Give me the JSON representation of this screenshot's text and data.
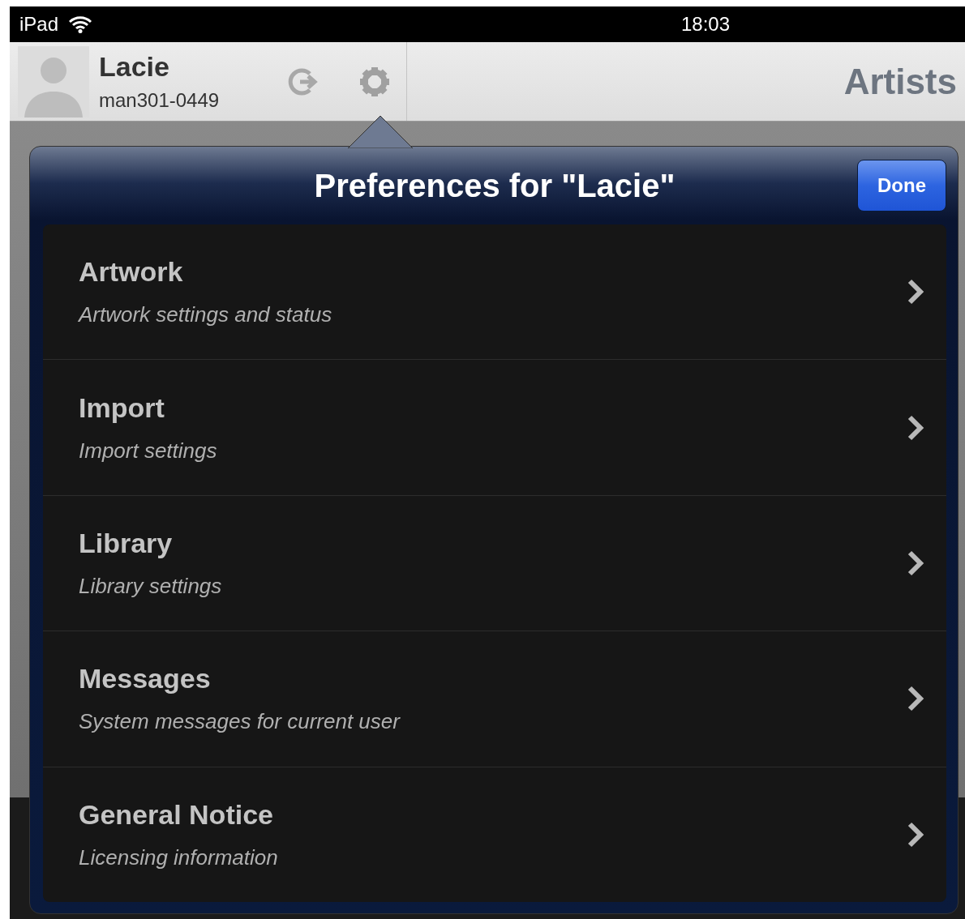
{
  "status_bar": {
    "device": "iPad",
    "time": "18:03"
  },
  "header": {
    "user_name": "Lacie",
    "user_id": "man301-0449",
    "title": "Artists"
  },
  "popover": {
    "title": "Preferences for \"Lacie\"",
    "done_button": "Done",
    "items": [
      {
        "title": "Artwork",
        "subtitle": "Artwork settings and status"
      },
      {
        "title": "Import",
        "subtitle": "Import settings"
      },
      {
        "title": "Library",
        "subtitle": "Library settings"
      },
      {
        "title": "Messages",
        "subtitle": "System messages for current user"
      },
      {
        "title": "General Notice",
        "subtitle": "Licensing information"
      }
    ]
  }
}
